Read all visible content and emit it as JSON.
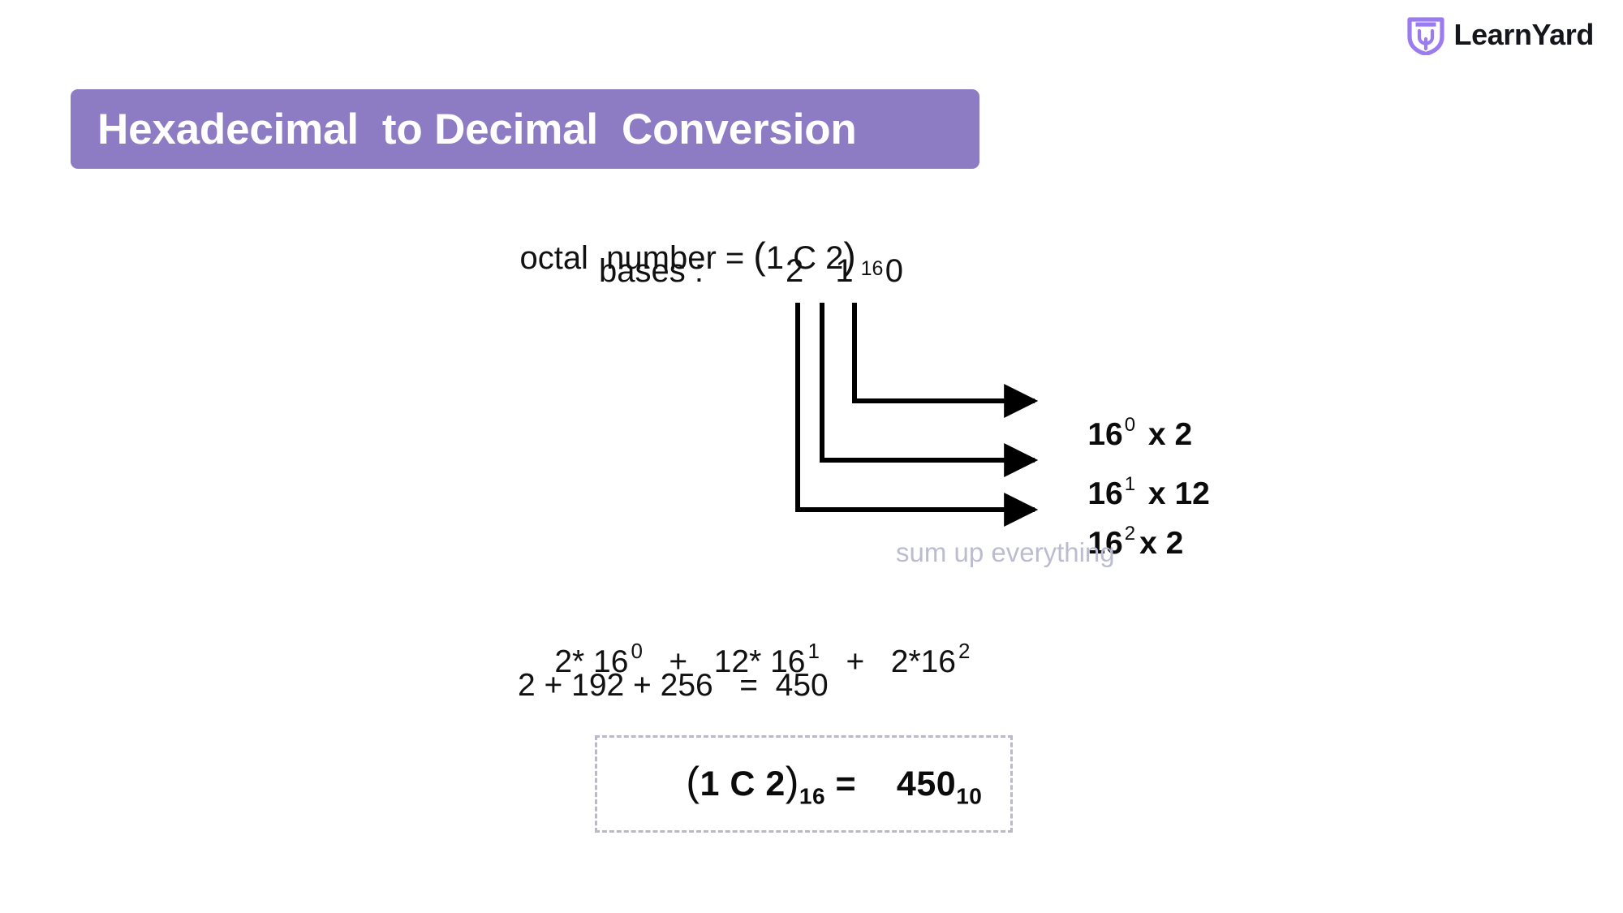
{
  "brand": {
    "name": "LearnYard",
    "logo_icon": "shield-logo-icon",
    "accent_color": "#8d7cc4"
  },
  "banner": {
    "title": "Hexadecimal  to Decimal  Conversion",
    "background_color": "#8d7cc4",
    "text_color": "#ffffff"
  },
  "problem": {
    "label": "octal  number = ",
    "open_paren": "(",
    "digits": "1 C 2",
    "close_paren": ")",
    "base_subscript": "16",
    "bases_label": "bases :",
    "bases_digits": "2 1 0"
  },
  "arrows": [
    {
      "name": "arrow-row-0",
      "base": "16",
      "exponent": "0",
      "operator": " x ",
      "digit": "2"
    },
    {
      "name": "arrow-row-1",
      "base": "16",
      "exponent": "1",
      "operator": " x ",
      "digit": "12"
    },
    {
      "name": "arrow-row-2",
      "base": "16",
      "exponent": "2",
      "operator": "x ",
      "digit": "2"
    }
  ],
  "note": "sum up everything",
  "expansion": {
    "t0_coeff": "2* 16",
    "t0_exp": "0",
    "plus_1": "   +   ",
    "t1_coeff": "12* 16",
    "t1_exp": "1",
    "plus_2": "   +   ",
    "t2_coeff": "2*16",
    "t2_exp": "2"
  },
  "total": "2 + 192 + 256   =  450",
  "result": {
    "open_paren": "(",
    "digits": "1 C 2",
    "close_paren": ")",
    "from_base": "16",
    "equals": " = ",
    "value": "   450",
    "to_base": "10",
    "border_color": "#b9b9c9"
  },
  "chart_data": {
    "type": "diagram",
    "title": "Hexadecimal to Decimal Conversion",
    "input_value": "1C2",
    "input_base": 16,
    "digits": [
      "1",
      "C",
      "2"
    ],
    "digit_decimal_values": [
      1,
      12,
      2
    ],
    "positional_exponents": [
      2,
      1,
      0
    ],
    "terms": [
      "16^0 x 2",
      "16^1 x 12",
      "16^2 x 2"
    ],
    "products": [
      2,
      192,
      256
    ],
    "sum": 450,
    "output_value": "450",
    "output_base": 10
  }
}
